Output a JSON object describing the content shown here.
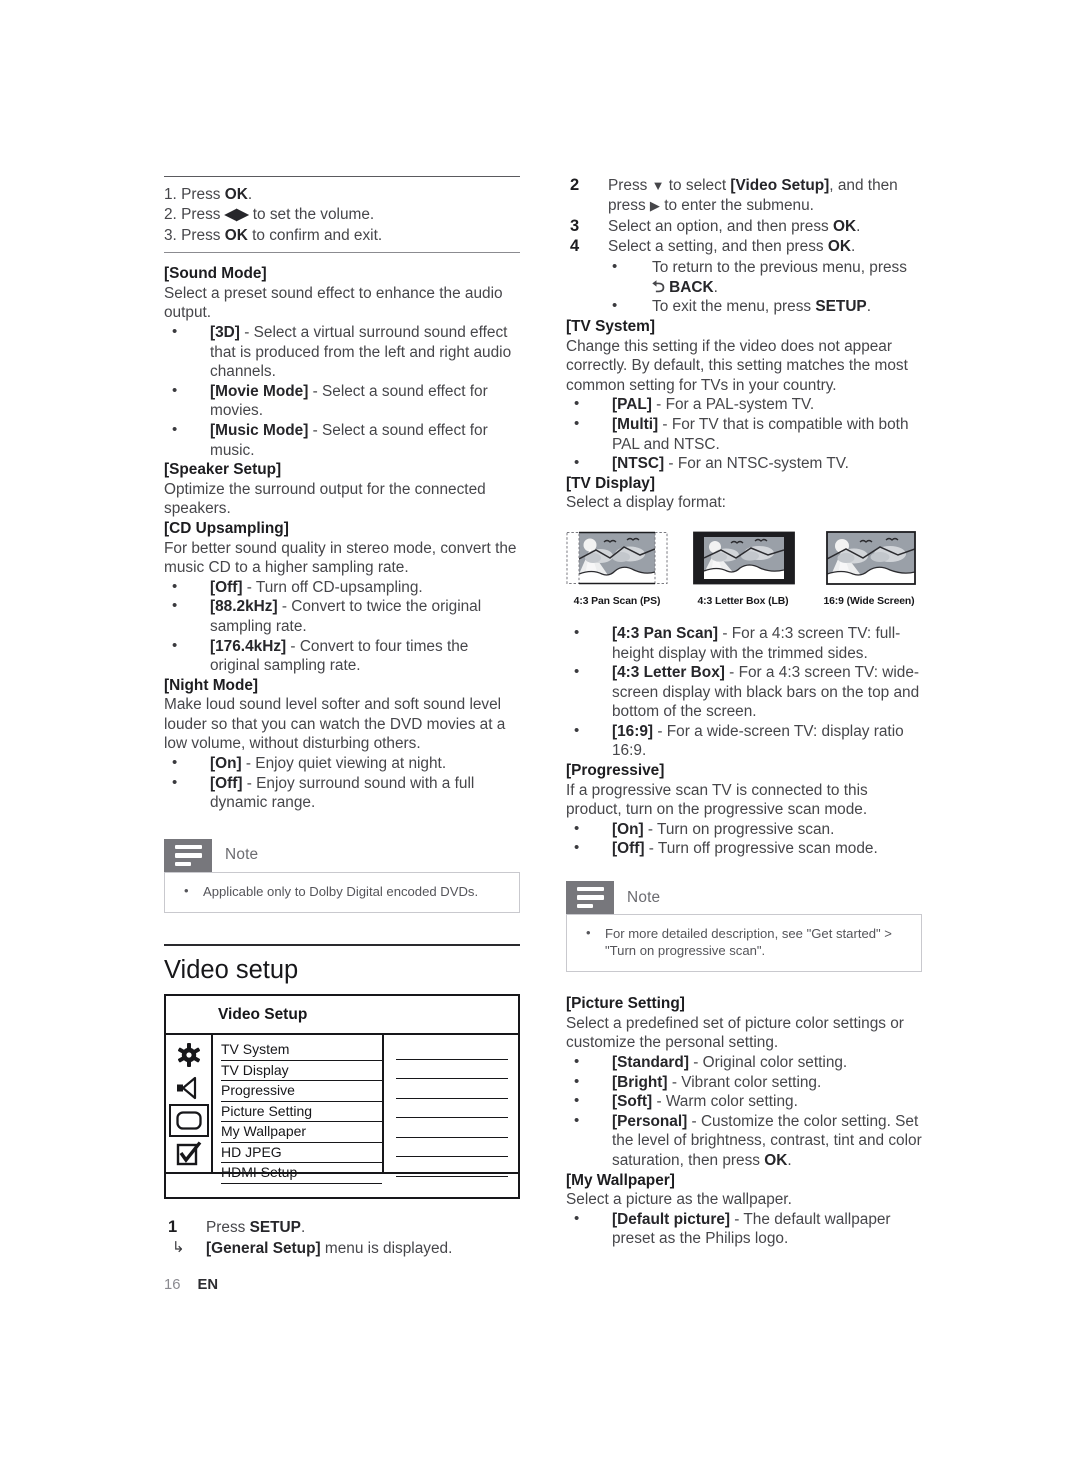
{
  "page": {
    "folio_number": "16",
    "folio_lang": "EN"
  },
  "left_column": {
    "steps_block": [
      {
        "num": "1.",
        "text_before": "Press ",
        "bold": "OK",
        "text_after": "."
      },
      {
        "num": "2.",
        "text_before": "Press ",
        "bold": "◀▶",
        "text_after": " to set the volume."
      },
      {
        "num": "3.",
        "text_before": "Press ",
        "bold": "OK",
        "text_after": " to confirm and exit."
      }
    ],
    "sound_mode": {
      "heading": "[Sound Mode]",
      "body": "Select a preset sound effect to enhance the audio output.",
      "bullets": [
        {
          "term": "[3D]",
          "desc": " - Select a virtual surround sound effect that is produced from the left and right audio channels."
        },
        {
          "term": "[Movie Mode]",
          "desc": " - Select a sound effect for movies."
        },
        {
          "term": "[Music Mode]",
          "desc": " - Select a sound effect for music."
        }
      ]
    },
    "speaker_setup": {
      "heading": "[Speaker Setup]",
      "body": "Optimize the surround output for the connected speakers."
    },
    "cd_upsampling": {
      "heading": "[CD Upsampling]",
      "body": "For better sound quality in stereo mode, convert the music CD to a higher sampling rate.",
      "bullets": [
        {
          "term": "[Off]",
          "desc": " - Turn off CD-upsampling."
        },
        {
          "term": "[88.2kHz]",
          "desc": " - Convert to twice the original sampling rate."
        },
        {
          "term": "[176.4kHz]",
          "desc": " - Convert to four times the original sampling rate."
        }
      ]
    },
    "night_mode": {
      "heading": "[Night Mode]",
      "body": "Make loud sound level softer and soft sound level louder so that you can watch the DVD movies at a low volume, without disturbing others.",
      "bullets": [
        {
          "term": "[On]",
          "desc": " - Enjoy quiet viewing at night."
        },
        {
          "term": "[Off]",
          "desc": " - Enjoy surround sound with a full dynamic range."
        }
      ]
    },
    "note": {
      "title": "Note",
      "items": [
        "Applicable only to Dolby Digital encoded DVDs."
      ]
    },
    "video_setup_section": {
      "title": "Video setup",
      "menu": {
        "title": "Video Setup",
        "icons": [
          "gear-icon",
          "speaker-icon",
          "tv-icon",
          "checkbox-icon"
        ],
        "selected_icon_index": 2,
        "items": [
          "TV System",
          "TV Display",
          "Progressive",
          "Picture Setting",
          "My Wallpaper",
          "HD JPEG",
          "HDMI Setup"
        ]
      },
      "step": {
        "num": "1",
        "text_before": "Press ",
        "bold": "SETUP",
        "text_after": ".",
        "result_bold": "[General Setup]",
        "result_after": " menu is displayed."
      }
    }
  },
  "right_column": {
    "steps": [
      {
        "num": "2",
        "parts": [
          {
            "t": "Press ",
            "s": "n"
          },
          {
            "t": "▼",
            "s": "tri"
          },
          {
            "t": " to select ",
            "s": "n"
          },
          {
            "t": "[Video Setup]",
            "s": "b"
          },
          {
            "t": ", and then press ",
            "s": "n"
          },
          {
            "t": "▶",
            "s": "tri"
          },
          {
            "t": " to enter the submenu.",
            "s": "n"
          }
        ]
      },
      {
        "num": "3",
        "parts": [
          {
            "t": "Select an option, and then press ",
            "s": "n"
          },
          {
            "t": "OK",
            "s": "b"
          },
          {
            "t": ".",
            "s": "n"
          }
        ]
      },
      {
        "num": "4",
        "parts": [
          {
            "t": "Select a setting, and then press ",
            "s": "n"
          },
          {
            "t": "OK",
            "s": "b"
          },
          {
            "t": ".",
            "s": "n"
          }
        ]
      }
    ],
    "step_bullets": [
      {
        "text": "To return to the previous menu, press ",
        "glyph": "⮌",
        "bold": "BACK",
        "tail": "."
      },
      {
        "text": "To exit the menu, press ",
        "glyph": "",
        "bold": "SETUP",
        "tail": "."
      }
    ],
    "tv_system": {
      "heading": "[TV System]",
      "body": "Change this setting if the video does not appear correctly. By default, this setting matches the most common setting for TVs in your country.",
      "bullets": [
        {
          "term": "[PAL]",
          "desc": " - For a PAL-system TV."
        },
        {
          "term": "[Multi]",
          "desc": " - For TV that is compatible with both PAL and NTSC."
        },
        {
          "term": "[NTSC]",
          "desc": " - For an NTSC-system TV."
        }
      ]
    },
    "tv_display": {
      "heading": "[TV Display]",
      "body": "Select a display format:",
      "figures": [
        {
          "caption": "4:3 Pan Scan (PS)",
          "mode": "pan-scan"
        },
        {
          "caption": "4:3 Letter Box (LB)",
          "mode": "letter-box"
        },
        {
          "caption": "16:9 (Wide Screen)",
          "mode": "wide-screen"
        }
      ],
      "bullets": [
        {
          "term": "[4:3 Pan Scan]",
          "desc": " - For a 4:3 screen TV: full-height display with the trimmed sides."
        },
        {
          "term": "[4:3 Letter Box]",
          "desc": " - For a 4:3 screen TV: wide-screen display with black bars on the top and bottom of the screen."
        },
        {
          "term": "[16:9]",
          "desc": " - For a wide-screen TV: display ratio 16:9."
        }
      ]
    },
    "progressive": {
      "heading": "[Progressive]",
      "body": "If a progressive scan TV is connected to this product, turn on the progressive scan mode.",
      "bullets": [
        {
          "term": "[On]",
          "desc": " - Turn on progressive scan."
        },
        {
          "term": "[Off]",
          "desc": " - Turn off progressive scan mode."
        }
      ]
    },
    "note": {
      "title": "Note",
      "items": [
        "For more detailed description, see \"Get started\" > \"Turn on progressive scan\"."
      ]
    },
    "picture_setting": {
      "heading": "[Picture Setting]",
      "body": "Select a predefined set of picture color settings or customize the personal setting.",
      "bullets": [
        {
          "term": "[Standard]",
          "desc": " - Original color setting."
        },
        {
          "term": "[Bright]",
          "desc": " - Vibrant color setting."
        },
        {
          "term": "[Soft]",
          "desc": " - Warm color setting."
        },
        {
          "term": "[Personal]",
          "desc": " - Customize the color setting. Set the level of brightness, contrast, tint and color saturation, then press ",
          "bold_tail": "OK",
          "tail": "."
        }
      ]
    },
    "my_wallpaper": {
      "heading": "[My Wallpaper]",
      "body": "Select a picture as the wallpaper.",
      "bullets": [
        {
          "term": "[Default picture]",
          "desc": " - The default wallpaper preset as the Philips logo."
        }
      ]
    }
  },
  "colors": {
    "body_text": "#46464a",
    "heading_text": "#1d1d20",
    "note_tab": "#77777c",
    "note_border": "#c9c9ce",
    "menu_stroke": "#17171a",
    "sky": "#9aa0a8"
  }
}
